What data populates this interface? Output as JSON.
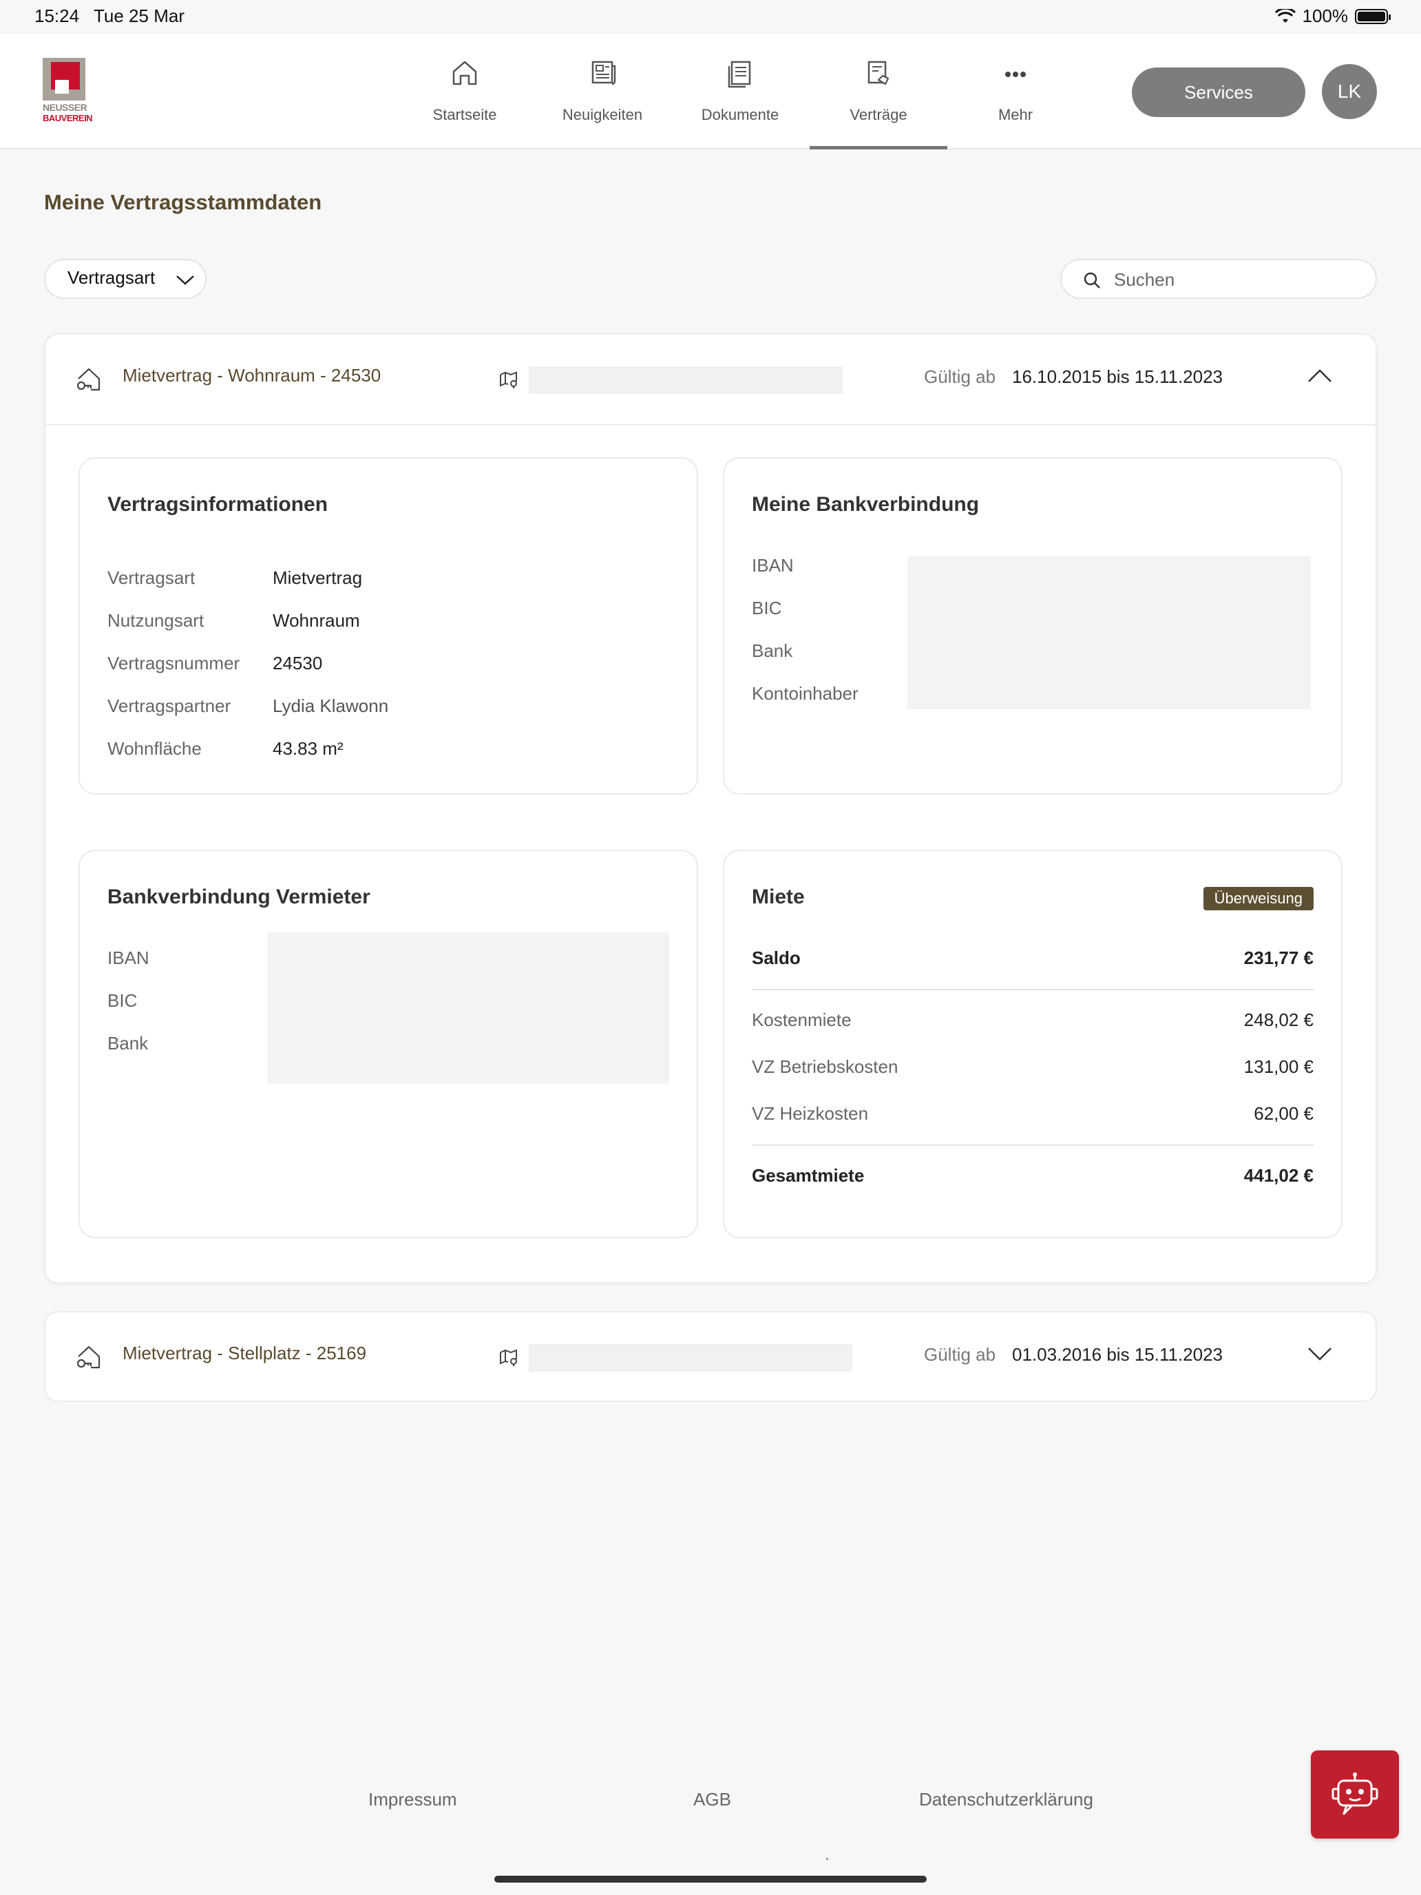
{
  "status_bar": {
    "time": "15:24",
    "date": "Tue 25 Mar",
    "battery": "100%"
  },
  "logo": {
    "line1": "NEUSSER",
    "line2": "BAUVEREIN"
  },
  "nav": [
    {
      "label": "Startseite",
      "icon": "home-icon"
    },
    {
      "label": "Neuigkeiten",
      "icon": "newspaper-icon"
    },
    {
      "label": "Dokumente",
      "icon": "document-icon"
    },
    {
      "label": "Verträge",
      "icon": "contract-icon",
      "active": true
    },
    {
      "label": "Mehr",
      "icon": "more-icon"
    }
  ],
  "services_label": "Services",
  "avatar_initials": "LK",
  "page_title": "Meine Vertragsstammdaten",
  "filter": {
    "label": "Vertragsart"
  },
  "search": {
    "placeholder": "Suchen"
  },
  "contracts": [
    {
      "title": "Mietvertrag - Wohnraum - 24530",
      "valid_label": "Gültig ab",
      "valid_range": "16.10.2015 bis 15.11.2023",
      "expanded": true,
      "vertragsinfo": {
        "heading": "Vertragsinformationen",
        "rows": [
          {
            "label": "Vertragsart",
            "value": "Mietvertrag"
          },
          {
            "label": "Nutzungsart",
            "value": "Wohnraum"
          },
          {
            "label": "Vertragsnummer",
            "value": "24530"
          },
          {
            "label": "Vertragspartner",
            "value": "Lydia Klawonn"
          },
          {
            "label": "Wohnfläche",
            "value": "43.83 m²"
          }
        ]
      },
      "bank": {
        "heading": "Meine Bankverbindung",
        "labels": [
          "IBAN",
          "BIC",
          "Bank",
          "Kontoinhaber"
        ]
      },
      "bank_landlord": {
        "heading": "Bankverbindung Vermieter",
        "labels": [
          "IBAN",
          "BIC",
          "Bank"
        ]
      },
      "rent": {
        "heading": "Miete",
        "badge": "Überweisung",
        "saldo_label": "Saldo",
        "saldo_value": "231,77 €",
        "items": [
          {
            "label": "Kostenmiete",
            "value": "248,02 €"
          },
          {
            "label": "VZ Betriebskosten",
            "value": "131,00 €"
          },
          {
            "label": "VZ Heizkosten",
            "value": "62,00 €"
          }
        ],
        "total_label": "Gesamtmiete",
        "total_value": "441,02 €"
      }
    },
    {
      "title": "Mietvertrag - Stellplatz - 25169",
      "valid_label": "Gültig ab",
      "valid_range": "01.03.2016 bis 15.11.2023",
      "expanded": false
    }
  ],
  "footer": {
    "impressum": "Impressum",
    "agb": "AGB",
    "datenschutz": "Datenschutzerklärung"
  }
}
